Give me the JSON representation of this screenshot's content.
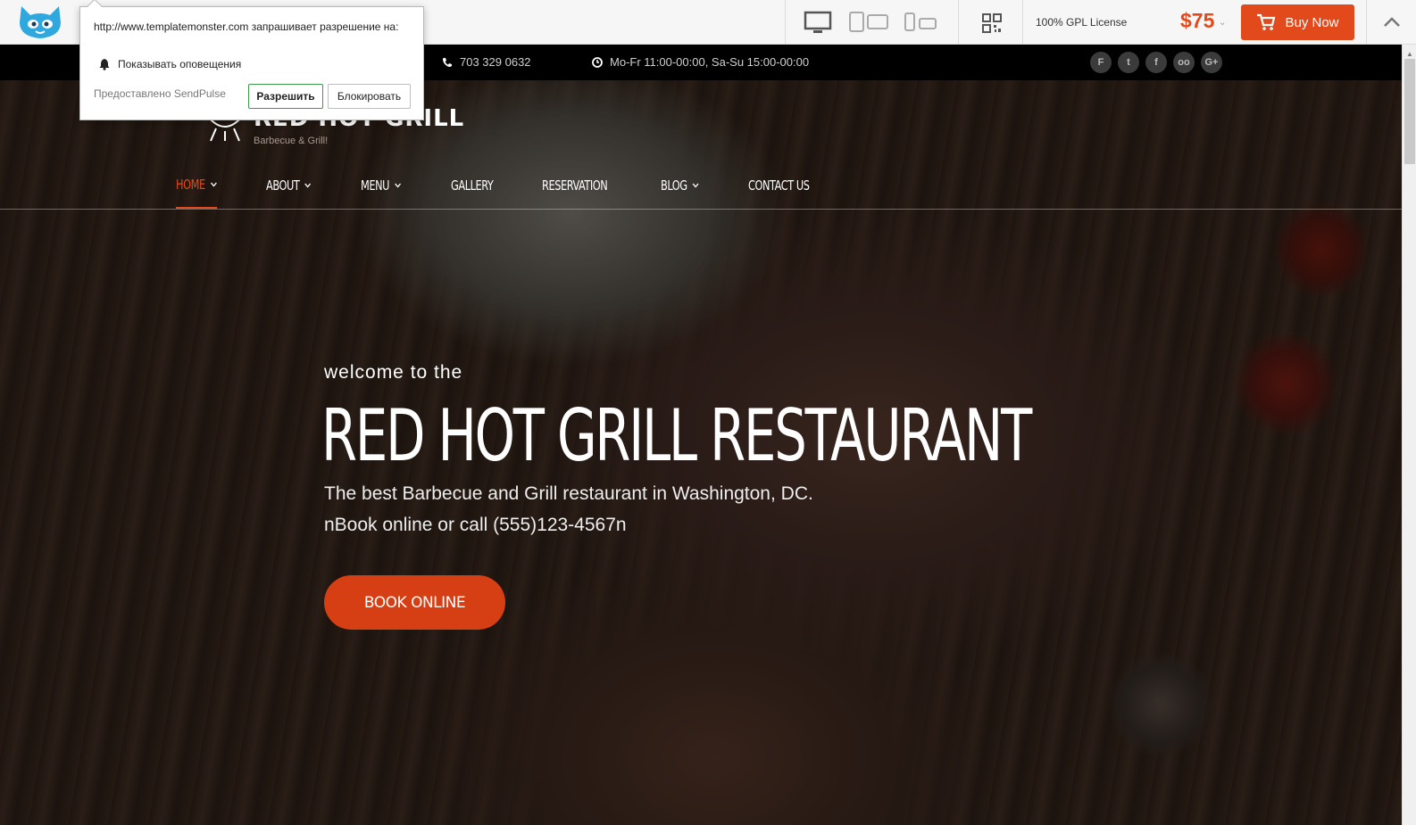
{
  "toolbar": {
    "logo_icon": "templatemonster-cat-icon",
    "devices": [
      "desktop-icon",
      "tablet-icon",
      "mobile-icon"
    ],
    "qr_icon": "qr-code-icon",
    "license": "100% GPL License",
    "price": "$75",
    "buy_label": "Buy Now",
    "cart_icon": "cart-icon",
    "collapse_icon": "chevron-up-icon"
  },
  "popup": {
    "message": "http://www.templatemonster.com запрашивает разрешение на:",
    "permission": "Показывать оповещения",
    "provided_by": "Предоставлено SendPulse",
    "allow_label": "Разрешить",
    "block_label": "Блокировать"
  },
  "infobar": {
    "phone": "703 329 0632",
    "hours": "Mo-Fr 11:00-00:00, Sa-Su 15:00-00:00",
    "socials": [
      "foursquare-icon",
      "twitter-icon",
      "facebook-icon",
      "tripadvisor-icon",
      "google-plus-icon"
    ]
  },
  "site": {
    "logo_name": "RED HOT GRILL",
    "logo_tagline": "Barbecue & Grill!"
  },
  "nav": {
    "items": [
      {
        "label": "HOME",
        "dropdown": true,
        "active": true
      },
      {
        "label": "ABOUT",
        "dropdown": true,
        "active": false
      },
      {
        "label": "MENU",
        "dropdown": true,
        "active": false
      },
      {
        "label": "GALLERY",
        "dropdown": false,
        "active": false
      },
      {
        "label": "RESERVATION",
        "dropdown": false,
        "active": false
      },
      {
        "label": "BLOG",
        "dropdown": true,
        "active": false
      },
      {
        "label": "CONTACT US",
        "dropdown": false,
        "active": false
      }
    ]
  },
  "hero": {
    "welcome": "welcome to the",
    "headline": "RED HOT GRILL RESTAURANT",
    "sub1": "The best Barbecue and Grill restaurant in Washington, DC.",
    "sub2": "nBook online or call (555)123-4567n",
    "cta": "BOOK ONLINE"
  },
  "colors": {
    "accent": "#e24a1c",
    "button": "#d63f13",
    "infobar_bg": "#000000"
  }
}
